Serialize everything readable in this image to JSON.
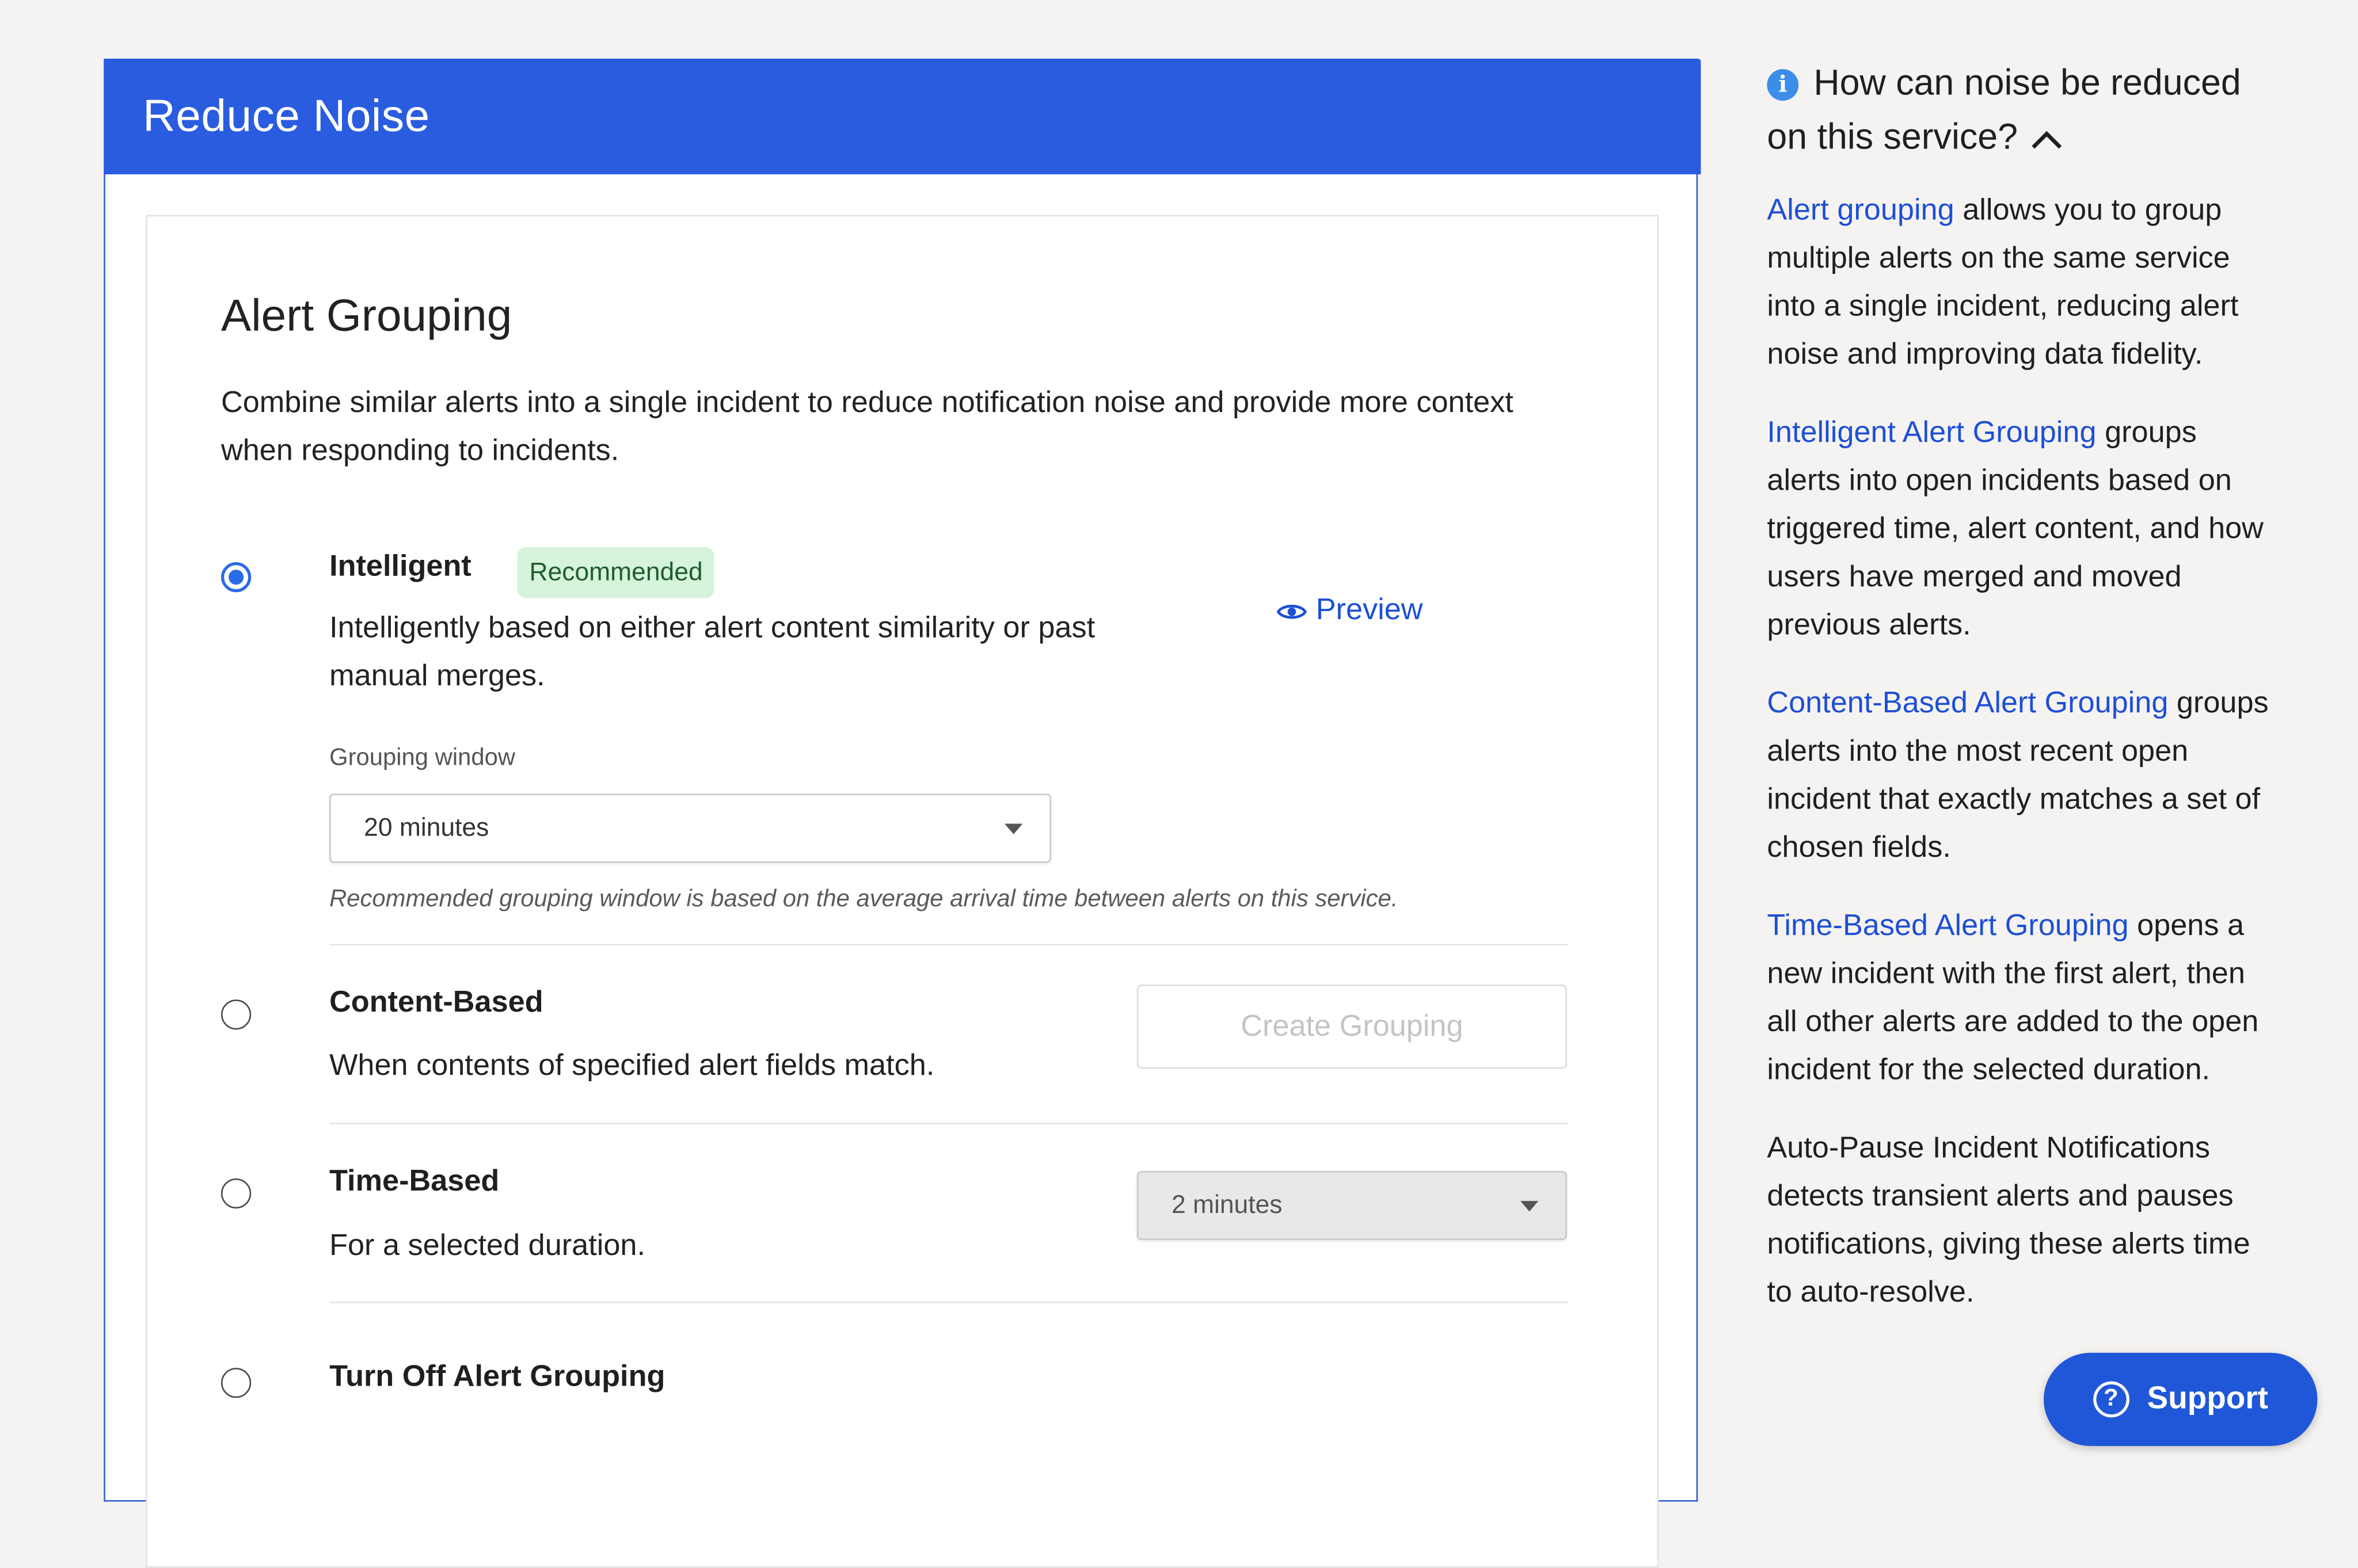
{
  "header": {
    "title": "Reduce Noise"
  },
  "section": {
    "title": "Alert Grouping",
    "description": "Combine similar alerts into a single incident to reduce notification noise and provide more context when responding to incidents."
  },
  "options": {
    "intelligent": {
      "title": "Intelligent",
      "badge": "Recommended",
      "description": "Intelligently based on either alert content similarity or past manual merges.",
      "selected": true,
      "preview_label": "Preview",
      "window_label": "Grouping window",
      "window_value": "20 minutes",
      "hint": "Recommended grouping window is based on the average arrival time between alerts on this service."
    },
    "content": {
      "title": "Content-Based",
      "description": "When contents of specified alert fields match.",
      "button_label": "Create Grouping"
    },
    "time": {
      "title": "Time-Based",
      "description": "For a selected duration.",
      "duration_value": "2 minutes"
    },
    "off": {
      "title": "Turn Off Alert Grouping"
    }
  },
  "sidebar": {
    "heading": "How can noise be reduced on this service?",
    "p1_link": "Alert grouping",
    "p1_text": " allows you to group multiple alerts on the same service into a single incident, reducing alert noise and improving data fidelity.",
    "p2_link": "Intelligent Alert Grouping",
    "p2_text": " groups alerts into open incidents based on triggered time, alert content, and how users have merged and moved previous alerts.",
    "p3_link": "Content-Based Alert Grouping",
    "p3_text": " groups alerts into the most recent open incident that exactly matches a set of chosen fields.",
    "p4_link": "Time-Based Alert Grouping",
    "p4_text": " opens a new incident with the first alert, then all other alerts are added to the open incident for the selected duration.",
    "p5_text": "Auto-Pause Incident Notifications detects transient alerts and pauses notifications, giving these alerts time to auto-resolve."
  },
  "support": {
    "label": "Support"
  },
  "colors": {
    "header_blue": "#2a5ce0",
    "link_blue": "#1d4fd6",
    "badge_bg": "#d6f3dc",
    "support_blue": "#1f57d8"
  }
}
